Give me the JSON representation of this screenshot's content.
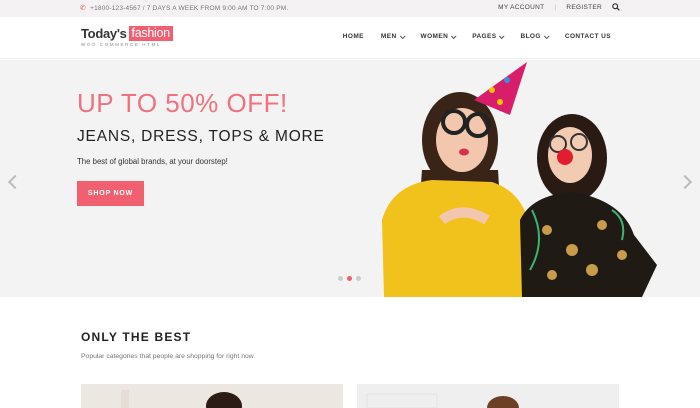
{
  "topbar": {
    "phone": "+1800-123-4567 / 7 DAYS A WEEK FROM 9:00 AM TO 7:00 PM.",
    "my_account": "MY ACCOUNT",
    "separator": "|",
    "register": "REGISTER"
  },
  "logo": {
    "text": "Today's",
    "brand": "fashion",
    "tagline": "WOO COMMERCE HTML"
  },
  "nav": {
    "items": [
      {
        "label": "HOME",
        "has_dropdown": false
      },
      {
        "label": "MEN",
        "has_dropdown": true
      },
      {
        "label": "WOMEN",
        "has_dropdown": true
      },
      {
        "label": "PAGES",
        "has_dropdown": true
      },
      {
        "label": "BLOG",
        "has_dropdown": true
      },
      {
        "label": "CONTACT US",
        "has_dropdown": false
      }
    ]
  },
  "hero": {
    "headline": "UP TO 50% OFF!",
    "subheadline": "JEANS, DRESS, TOPS & MORE",
    "description": "The best of global brands, at your doorstep!",
    "cta": "SHOP NOW",
    "slide_count": 3,
    "active_slide": 2
  },
  "section": {
    "title": "ONLY THE BEST",
    "subtitle": "Popular categories that people are shopping for right now."
  },
  "colors": {
    "accent": "#f06070",
    "topbar_bg": "#f4f2f2",
    "hero_bg": "#f3f3f3"
  }
}
